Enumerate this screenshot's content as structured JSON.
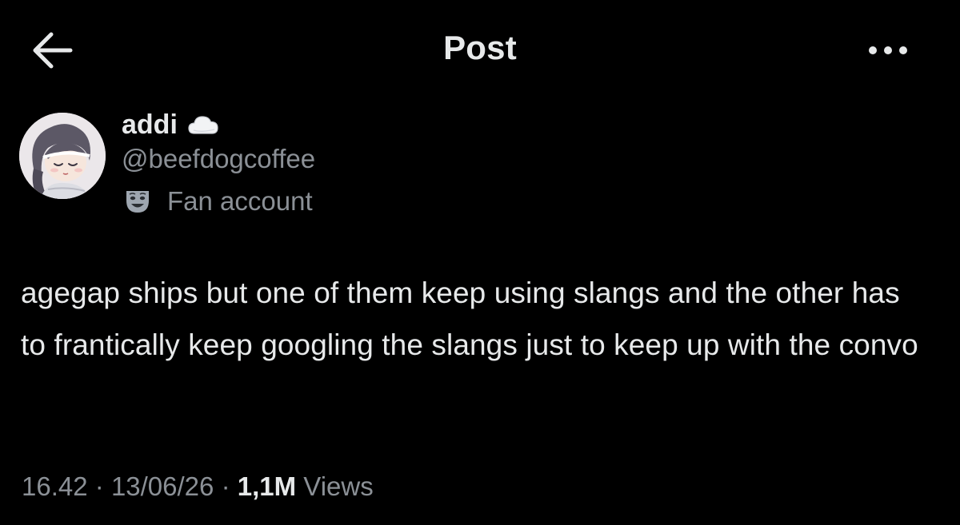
{
  "header": {
    "title": "Post",
    "back_icon": "arrow-left-icon",
    "more_icon": "more-horizontal-icon"
  },
  "author": {
    "display_name": "addi",
    "name_emoji_icon": "cloud-icon",
    "handle": "@beefdogcoffee",
    "label_icon": "theater-masks-icon",
    "label": "Fan account"
  },
  "post": {
    "text": "agegap ships but one of them keep using slangs and the other has to frantically keep googling the slangs just to keep up with the convo"
  },
  "meta": {
    "time": "16.42",
    "date": "13/06/26",
    "views_count": "1,1M",
    "views_label": "Views",
    "separator": "·"
  },
  "colors": {
    "background": "#000000",
    "primary_text": "#e7e9ea",
    "secondary_text": "#8b9096"
  }
}
